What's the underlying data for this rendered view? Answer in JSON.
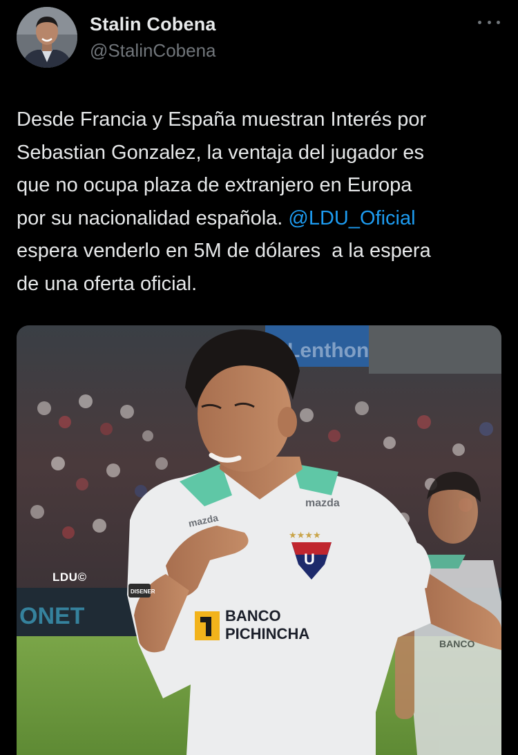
{
  "author": {
    "name": "Stalin Cobena",
    "handle": "@StalinCobena",
    "avatar": "profile-photo"
  },
  "menu": {
    "icon": "more-options-icon"
  },
  "tweet": {
    "text_part1": "Desde Francia y España muestran Interés por\nSebastian Gonzalez, la ventaja del jugador es\nque no ocupa plaza de extranjero en Europa\npor su nacionalidad española. ",
    "mention": "@LDU_Oficial",
    "text_part2": "\nespera venderlo en 5M de dólares  a la espera\nde una oferta oficial."
  },
  "media": {
    "watermark": "LDU©",
    "sponsor_line1": "BANCO",
    "sponsor_line2": "PICHINCHA",
    "shirt_brand": "mazda",
    "stars": "★★★★",
    "crest_letter": "U",
    "banner_text": "Lenthon",
    "ad_text": "ONET",
    "sleeve_patch": "DISENER",
    "colors": {
      "shirt": "#ecedee",
      "collar": "#5fc7a6",
      "pitch": "#6f9a3f",
      "crest_red": "#c0262e",
      "crest_blue": "#1d2a6b"
    }
  },
  "theme": {
    "background": "#000000",
    "text": "#e7e9ea",
    "secondary": "#71767b",
    "link": "#1d9bf0"
  }
}
